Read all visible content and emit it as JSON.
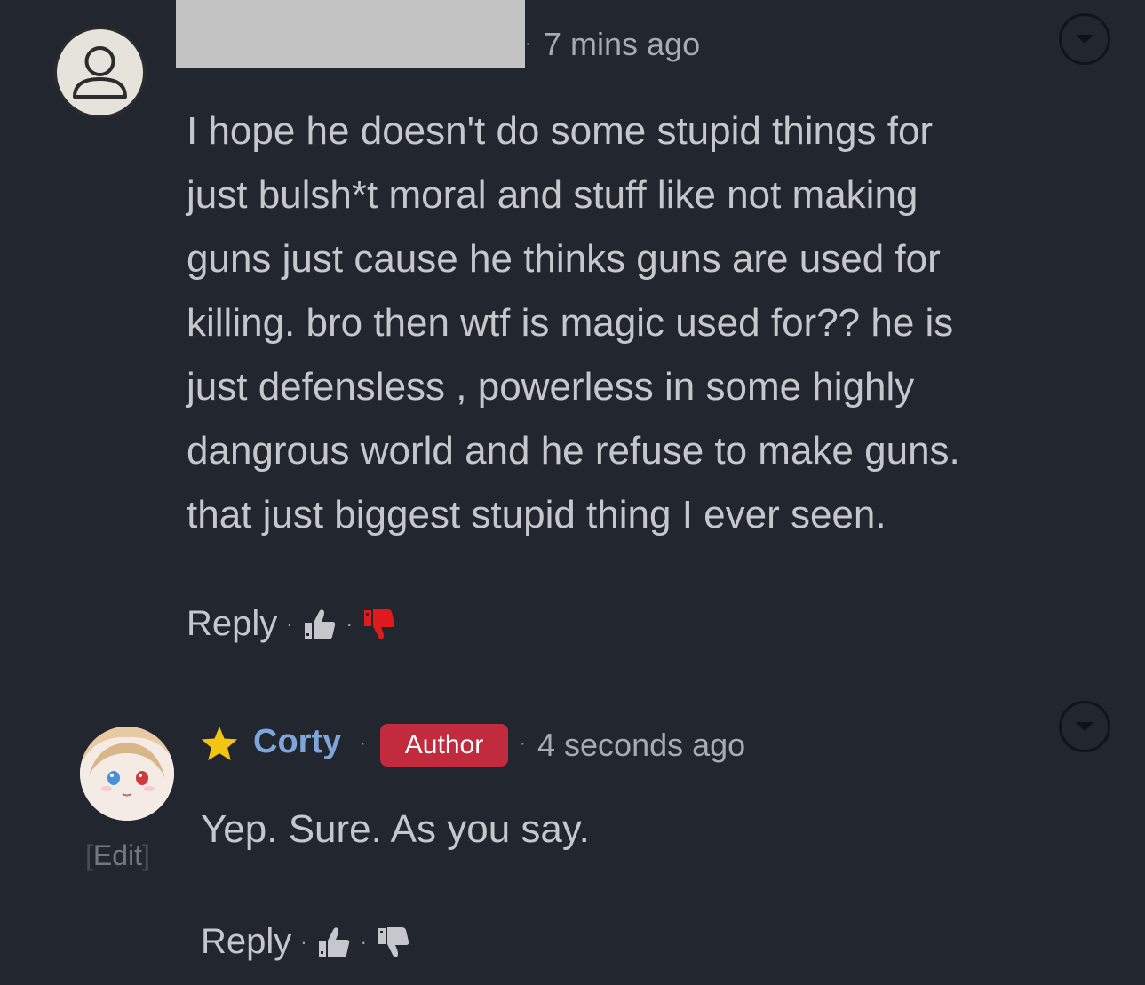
{
  "comments": [
    {
      "username": "",
      "timestamp": "7 mins ago",
      "body": "I hope he doesn't do some stupid things for\njust bulsh*t moral and stuff like not making\nguns just cause he thinks guns are used for\nkilling. bro then wtf is magic used for?? he is\njust defensless , powerless in some highly\ndangrous world and he refuse to make guns.\nthat just biggest stupid thing I ever seen.",
      "reply_label": "Reply",
      "dislike_active_color": "#e01b1b"
    },
    {
      "username": "Corty",
      "badge": "Author",
      "timestamp": "4 seconds ago",
      "body": "Yep. Sure. As you say.",
      "reply_label": "Reply",
      "edit_label": "Edit",
      "badge_color": "#c22a3d",
      "name_color": "#7ea6d8",
      "star_color": "#f2c414"
    }
  ],
  "separator": "·"
}
